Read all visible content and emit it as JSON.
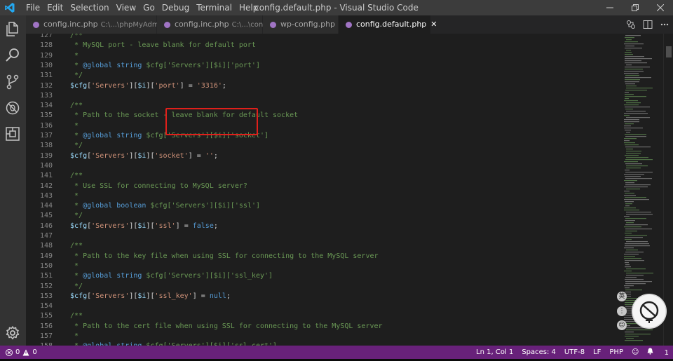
{
  "window": {
    "title": "config.default.php - Visual Studio Code",
    "menu": [
      "File",
      "Edit",
      "Selection",
      "View",
      "Go",
      "Debug",
      "Terminal",
      "Help"
    ]
  },
  "tabs": [
    {
      "name": "config.inc.php",
      "path": "C:\\...\\phpMyAdmin",
      "active": false
    },
    {
      "name": "config.inc.php",
      "path": "C:\\...\\config",
      "active": false
    },
    {
      "name": "wp-config.php",
      "path": "",
      "active": false
    },
    {
      "name": "config.default.php",
      "path": "",
      "active": true
    }
  ],
  "code_lines": [
    {
      "n": "127",
      "t": " /**",
      "k": "cm"
    },
    {
      "n": "128",
      "t": "  * MySQL port - leave blank for default port",
      "k": "cm"
    },
    {
      "n": "129",
      "t": "  *",
      "k": "cm"
    },
    {
      "n": "130",
      "t": "  * @global string $cfg['Servers'][$i]['port']",
      "k": "doc"
    },
    {
      "n": "131",
      "t": "  */",
      "k": "cm"
    },
    {
      "n": "132",
      "t": " $cfg['Servers'][$i]['port'] = '3316';",
      "k": "code"
    },
    {
      "n": "133",
      "t": "",
      "k": "blank"
    },
    {
      "n": "134",
      "t": " /**",
      "k": "cm"
    },
    {
      "n": "135",
      "t": "  * Path to the socket - leave blank for default socket",
      "k": "cm"
    },
    {
      "n": "136",
      "t": "  *",
      "k": "cm"
    },
    {
      "n": "137",
      "t": "  * @global string $cfg['Servers'][$i]['socket']",
      "k": "doc"
    },
    {
      "n": "138",
      "t": "  */",
      "k": "cm"
    },
    {
      "n": "139",
      "t": " $cfg['Servers'][$i]['socket'] = '';",
      "k": "code"
    },
    {
      "n": "140",
      "t": "",
      "k": "blank"
    },
    {
      "n": "141",
      "t": " /**",
      "k": "cm"
    },
    {
      "n": "142",
      "t": "  * Use SSL for connecting to MySQL server?",
      "k": "cm"
    },
    {
      "n": "143",
      "t": "  *",
      "k": "cm"
    },
    {
      "n": "144",
      "t": "  * @global boolean $cfg['Servers'][$i]['ssl']",
      "k": "doc"
    },
    {
      "n": "145",
      "t": "  */",
      "k": "cm"
    },
    {
      "n": "146",
      "t": " $cfg['Servers'][$i]['ssl'] = false;",
      "k": "code"
    },
    {
      "n": "147",
      "t": "",
      "k": "blank"
    },
    {
      "n": "148",
      "t": " /**",
      "k": "cm"
    },
    {
      "n": "149",
      "t": "  * Path to the key file when using SSL for connecting to the MySQL server",
      "k": "cm"
    },
    {
      "n": "150",
      "t": "  *",
      "k": "cm"
    },
    {
      "n": "151",
      "t": "  * @global string $cfg['Servers'][$i]['ssl_key']",
      "k": "doc"
    },
    {
      "n": "152",
      "t": "  */",
      "k": "cm"
    },
    {
      "n": "153",
      "t": " $cfg['Servers'][$i]['ssl_key'] = null;",
      "k": "code"
    },
    {
      "n": "154",
      "t": "",
      "k": "blank"
    },
    {
      "n": "155",
      "t": " /**",
      "k": "cm"
    },
    {
      "n": "156",
      "t": "  * Path to the cert file when using SSL for connecting to the MySQL server",
      "k": "cm"
    },
    {
      "n": "157",
      "t": "  *",
      "k": "cm"
    },
    {
      "n": "158",
      "t": "  * @global string $cfg['Servers'][$i]['ssl_cert']",
      "k": "doc"
    }
  ],
  "float_icons": [
    "英",
    "⋮",
    "☺"
  ],
  "status": {
    "errors": "0",
    "warnings": "0",
    "position": "Ln 1, Col 1",
    "spaces": "Spaces: 4",
    "encoding": "UTF-8",
    "eol": "LF",
    "language": "PHP",
    "notifications": "1"
  },
  "colors": {
    "statusbar": "#68217a",
    "highlight_box": "#e0201b",
    "comment": "#6a9955",
    "string": "#ce9178",
    "keyword": "#569cd6",
    "variable": "#9cdcfe"
  }
}
